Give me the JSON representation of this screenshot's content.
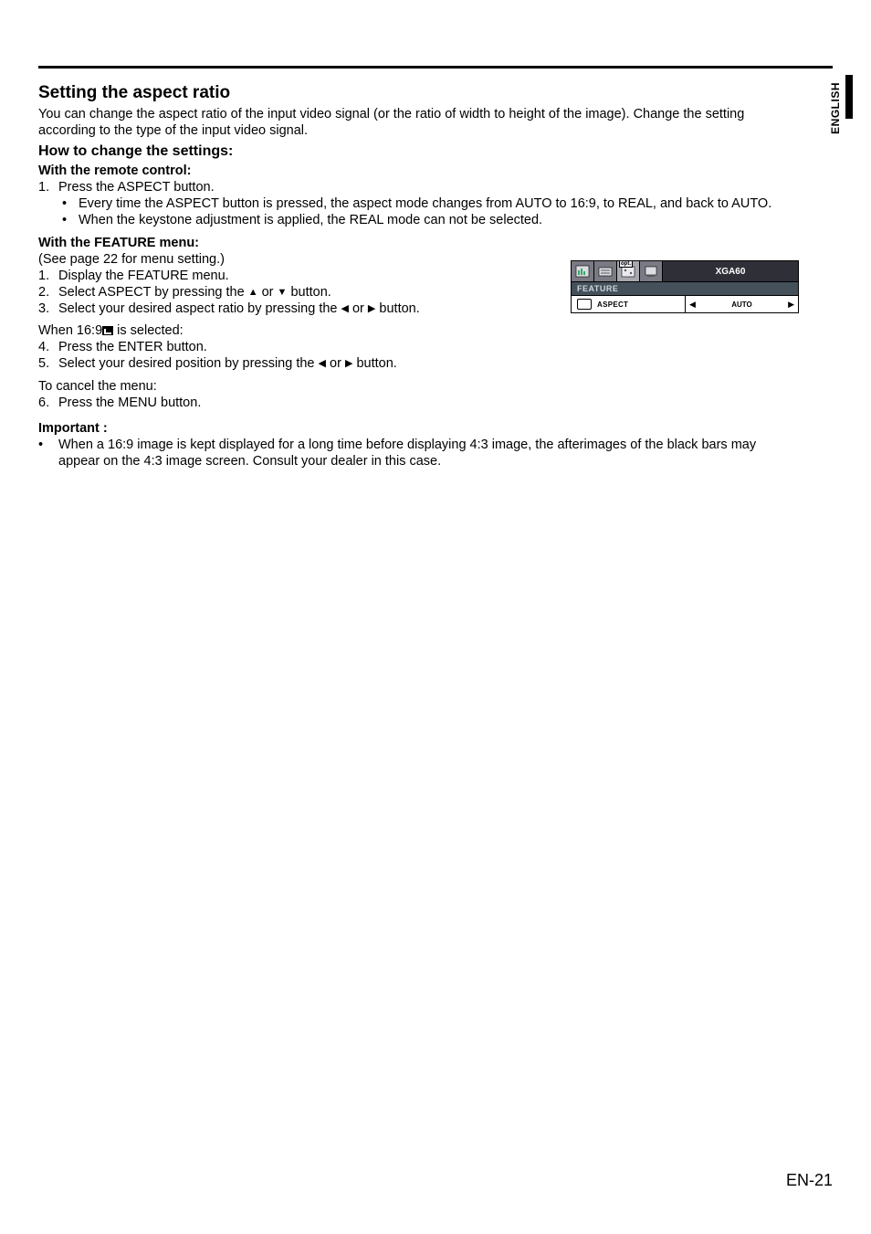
{
  "lang_tab": "ENGLISH",
  "title": "Setting the aspect ratio",
  "intro": "You can change the aspect ratio of the input video signal (or the ratio of width to height of the image). Change the setting according to the type of the input video signal.",
  "howto": "How to change the settings:",
  "remote_head": "With the remote control:",
  "step1": "Press the ASPECT button.",
  "step1_b1": "Every time the ASPECT button is pressed, the aspect mode changes from AUTO to 16:9, to REAL, and back to AUTO.",
  "step1_b2": "When the keystone adjustment is applied, the REAL mode can not be selected.",
  "feature_head": "With the FEATURE menu:",
  "feature_note": "(See page 22 for menu setting.)",
  "step_f1": "Display the FEATURE menu.",
  "step_f2a": "Select ASPECT by pressing the ",
  "step_f2b": " or ",
  "step_f2c": " button.",
  "step_f3a": "Select your desired aspect ratio by pressing the ",
  "step_f3b": " or ",
  "step_f3c": " button.",
  "when169": "When 16:9",
  "when169_suffix": " is selected:",
  "step_f4": "Press the ENTER button.",
  "step_f5a": "Select your desired position  by pressing the ",
  "step_f5b": " or ",
  "step_f5c": " button.",
  "cancel_head": "To cancel the menu:",
  "step_f6": "Press the MENU button.",
  "important_head": "Important :",
  "important_b1": "When a 16:9 image is kept displayed for a long time before displaying 4:3 image, the afterimages of the black bars may appear on the 4:3 image screen. Consult your dealer in this case.",
  "osd": {
    "tab_opt": "opt.",
    "resolution": "XGA60",
    "menu_name": "FEATURE",
    "setting_label": "ASPECT",
    "setting_value": "AUTO"
  },
  "page_number": "EN-21"
}
